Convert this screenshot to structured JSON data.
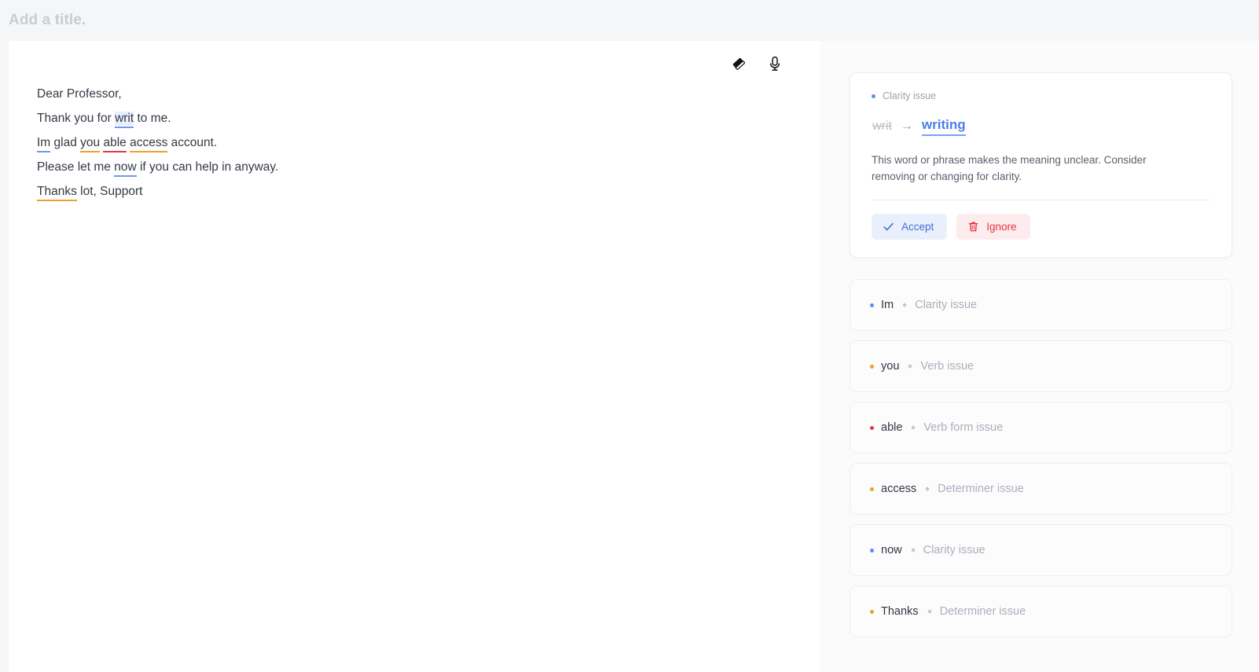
{
  "titlebar": {
    "title_placeholder": "Add a title."
  },
  "toolbar": {
    "eraser_label": "eraser-tool",
    "mic_label": "microphone-tool"
  },
  "document": {
    "lines": [
      {
        "segments": [
          {
            "text": "Dear Professor,"
          }
        ]
      },
      {
        "segments": [
          {
            "text": "Thank you for "
          },
          {
            "text": "writ",
            "mark": "blue",
            "active": true
          },
          {
            "text": " to me."
          }
        ]
      },
      {
        "segments": [
          {
            "text": "Im",
            "mark": "blue"
          },
          {
            "text": " glad "
          },
          {
            "text": "you",
            "mark": "orange"
          },
          {
            "text": " "
          },
          {
            "text": "able",
            "mark": "red"
          },
          {
            "text": " "
          },
          {
            "text": "access",
            "mark": "orange"
          },
          {
            "text": " account."
          }
        ]
      },
      {
        "segments": [
          {
            "text": "Please let me "
          },
          {
            "text": "now",
            "mark": "blue"
          },
          {
            "text": " if you can help in anyway."
          }
        ]
      },
      {
        "segments": [
          {
            "text": "Thanks",
            "mark": "orange"
          },
          {
            "text": " lot, Support"
          }
        ]
      }
    ]
  },
  "suggestions": {
    "expanded": {
      "type_label": "Clarity issue",
      "severity": "blue",
      "old_word": "writ",
      "arrow": "→",
      "new_word": "writing",
      "description": "This word or phrase makes the meaning unclear. Consider removing or changing for clarity.",
      "accept_label": "Accept",
      "ignore_label": "Ignore"
    },
    "collapsed": [
      {
        "word": "Im",
        "type_label": "Clarity issue",
        "severity": "blue"
      },
      {
        "word": "you",
        "type_label": "Verb issue",
        "severity": "orange"
      },
      {
        "word": "able",
        "type_label": "Verb form issue",
        "severity": "red"
      },
      {
        "word": "access",
        "type_label": "Determiner issue",
        "severity": "orange"
      },
      {
        "word": "now",
        "type_label": "Clarity issue",
        "severity": "blue"
      },
      {
        "word": "Thanks",
        "type_label": "Determiner issue",
        "severity": "orange"
      }
    ]
  },
  "colors": {
    "clarity": "#5b8def",
    "verb": "#f0a02a",
    "verb_form": "#e0384b",
    "determiner": "#f0a02a",
    "accept_text": "#3d6fd4",
    "ignore_text": "#e8323f",
    "suggestion_blue": "#4a7fe8"
  }
}
